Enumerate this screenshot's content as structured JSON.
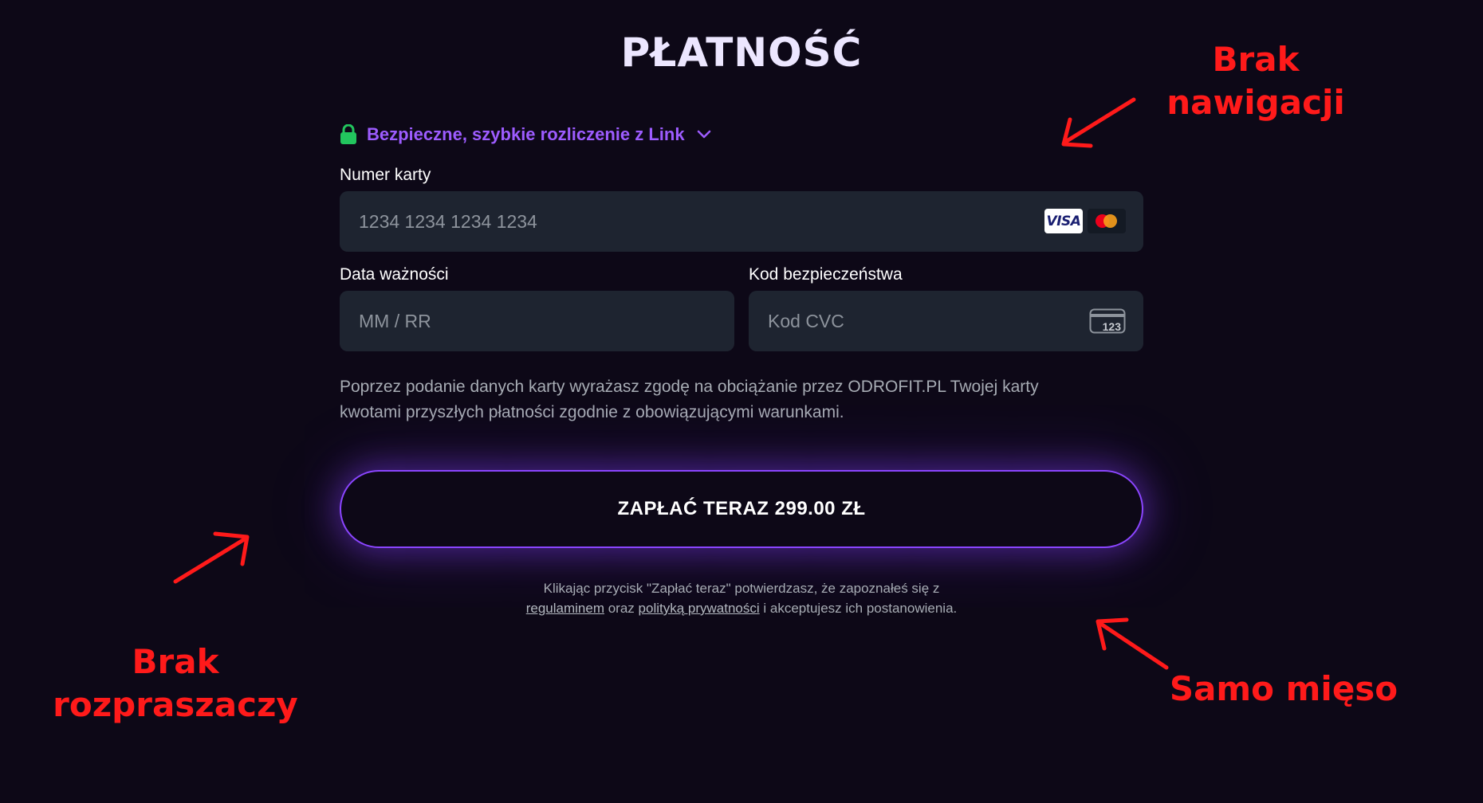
{
  "page": {
    "title": "PŁATNOŚĆ"
  },
  "link": {
    "text": "Bezpieczne, szybkie rozliczenie z Link"
  },
  "card_number": {
    "label": "Numer karty",
    "placeholder": "1234 1234 1234 1234",
    "visa_text": "VISA"
  },
  "expiry": {
    "label": "Data ważności",
    "placeholder": "MM / RR"
  },
  "cvc": {
    "label": "Kod bezpieczeństwa",
    "placeholder": "Kod CVC",
    "icon_text": "123"
  },
  "consent": {
    "line1": "Poprzez podanie danych karty wyrażasz zgodę na obciążanie przez ODROFIT.PL Twojej karty",
    "line2": "kwotami przyszłych płatności zgodnie z obowiązującymi warunkami."
  },
  "pay_button": {
    "label": "ZAPŁAĆ TERAZ 299.00 ZŁ"
  },
  "terms": {
    "line1": "Klikając przycisk \"Zapłać teraz\" potwierdzasz, że zapoznałeś się z",
    "link1": "regulaminem",
    "mid": " oraz ",
    "link2": "polityką prywatności",
    "end": " i akceptujesz ich postanowienia."
  },
  "annotations": {
    "top_right": {
      "line1": "Brak",
      "line2": "nawigacji"
    },
    "bottom_left": {
      "line1": "Brak",
      "line2": "rozpraszaczy"
    },
    "bottom_right": {
      "line1": "Samo mięso"
    }
  },
  "colors": {
    "background": "#0d0817",
    "accent_purple": "#9d5cff",
    "lock_green": "#22c55e",
    "input_bg": "#1e2430",
    "annotation_red": "#ff1a1a"
  },
  "icons": {
    "lock": "lock-icon",
    "chevron": "chevron-down-icon",
    "visa": "visa-icon",
    "mastercard": "mastercard-icon",
    "cvc": "cvc-card-icon",
    "arrow": "arrow-icon"
  }
}
